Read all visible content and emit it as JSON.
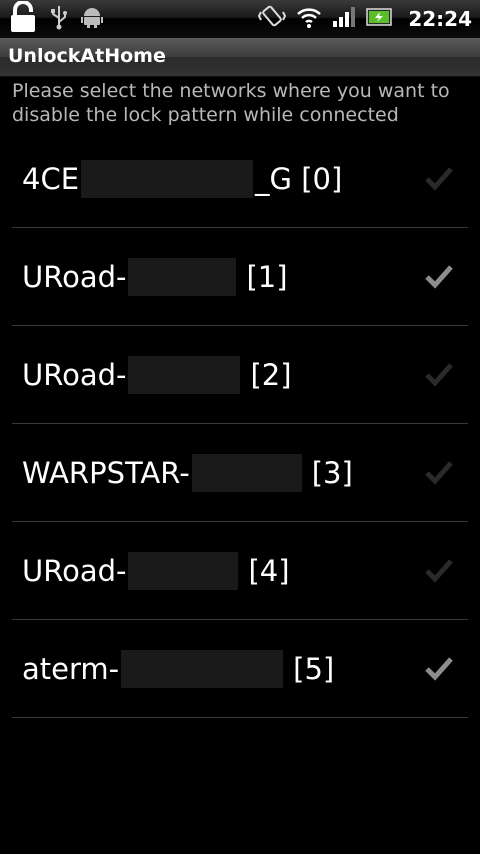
{
  "status": {
    "time": "22:24"
  },
  "app": {
    "title": "UnlockAtHome"
  },
  "instructions": "Please select the networks where you want to disable the lock pattern while connected",
  "networks": [
    {
      "prefix": "4CE",
      "suffix": "_G [0]",
      "checked": false
    },
    {
      "prefix": "URoad-",
      "suffix": "[1]",
      "checked": true
    },
    {
      "prefix": "URoad-",
      "suffix": "[2]",
      "checked": false
    },
    {
      "prefix": "WARPSTAR-",
      "suffix": "[3]",
      "checked": false
    },
    {
      "prefix": "URoad-",
      "suffix": "[4]",
      "checked": false
    },
    {
      "prefix": "aterm-",
      "suffix": "[5]",
      "checked": true
    }
  ],
  "colors": {
    "checked": "#8c8c8c",
    "unchecked": "#2a2a2a",
    "divider": "#3a3a3a"
  }
}
